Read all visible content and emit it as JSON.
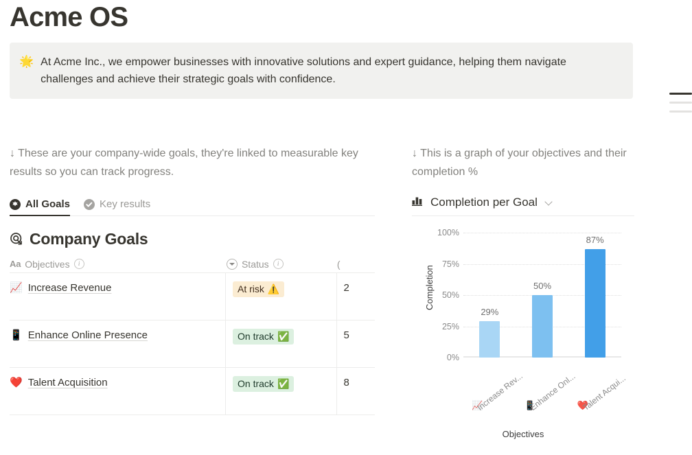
{
  "page": {
    "title": "Acme OS"
  },
  "callout": {
    "emoji": "🌟",
    "icon_name": "sparkle-star-emoji",
    "text": "At Acme Inc., we empower businesses with innovative solutions and expert guidance, helping them navigate challenges and achieve their strategic goals with confidence."
  },
  "toc": {
    "items": [
      "active",
      "dim",
      "dim"
    ]
  },
  "left": {
    "intro": "↓ These are your company-wide goals, they're linked to measurable key results so you can track progress.",
    "tabs": [
      {
        "label": "All Goals",
        "icon": "star-badge-icon",
        "active": true
      },
      {
        "label": "Key results",
        "icon": "check-circle-icon",
        "active": false
      }
    ],
    "section": {
      "icon": "goal-target-arrow-icon",
      "title": "Company Goals"
    },
    "table": {
      "headers": [
        {
          "label": "Objectives",
          "prefix": "Aa",
          "icon": "text-type-icon",
          "info": "i"
        },
        {
          "label": "Status",
          "icon": "select-caret-icon",
          "info": "i"
        },
        {
          "label": "(",
          "icon": "completion-icon",
          "info": ""
        }
      ],
      "rows": [
        {
          "emoji": "📈",
          "emoji_name": "chart-increasing-emoji",
          "objective": "Increase Revenue",
          "status": "At risk",
          "status_emoji": "⚠️",
          "status_kind": "risk",
          "completion": "2"
        },
        {
          "emoji": "📱",
          "emoji_name": "mobile-phone-emoji",
          "objective": "Enhance Online Presence",
          "status": "On track",
          "status_emoji": "✅",
          "status_kind": "ontrack",
          "completion": "5"
        },
        {
          "emoji": "❤️",
          "emoji_name": "red-heart-emoji",
          "objective": "Talent Acquisition",
          "status": "On track",
          "status_emoji": "✅",
          "status_kind": "ontrack",
          "completion": "8"
        }
      ]
    }
  },
  "right": {
    "intro": "↓ This is a graph of your objectives and their completion %",
    "chart_header": {
      "icon": "bar-chart-icon",
      "label": "Completion per Goal",
      "chevron": "chevron-down-icon"
    }
  },
  "chart_data": {
    "type": "bar",
    "title": "Completion per Goal",
    "categories": [
      "Increase Rev...",
      "Enhance Onl...",
      "Talent Acqui..."
    ],
    "category_emojis": [
      "📈",
      "📱",
      "❤️"
    ],
    "values": [
      29,
      50,
      87
    ],
    "value_labels": [
      "29%",
      "50%",
      "87%"
    ],
    "bar_colors": [
      "#a9d6f5",
      "#7dc0f0",
      "#429fe8"
    ],
    "xlabel": "Objectives",
    "ylabel": "Completion",
    "ylim": [
      0,
      100
    ],
    "yticks": [
      0,
      25,
      50,
      75,
      100
    ],
    "ytick_labels": [
      "0%",
      "25%",
      "50%",
      "75%",
      "100%"
    ],
    "grid": true,
    "legend": false
  }
}
